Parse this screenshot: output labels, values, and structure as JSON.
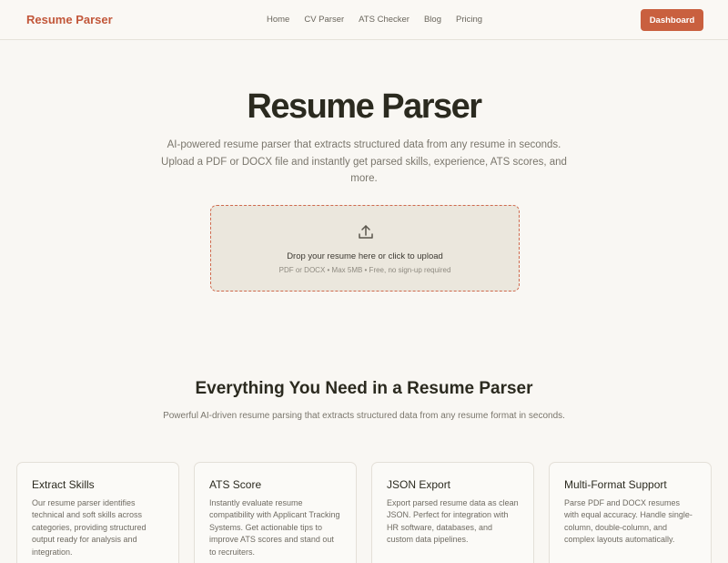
{
  "nav": {
    "brand": "Resume Parser",
    "links": [
      "Home",
      "CV Parser",
      "ATS Checker",
      "Blog",
      "Pricing"
    ],
    "dashboard_label": "Dashboard"
  },
  "hero": {
    "title": "Resume Parser",
    "subtitle": "AI-powered resume parser that extracts structured data from any resume in seconds. Upload a PDF or DOCX file and instantly get parsed skills, experience, ATS scores, and more."
  },
  "upload": {
    "icon": "upload-icon",
    "main_text": "Drop your resume here or click to upload",
    "hint": "PDF or DOCX • Max 5MB • Free, no sign-up required"
  },
  "features": {
    "title": "Everything You Need in a Resume Parser",
    "subtitle": "Powerful AI-driven resume parsing that extracts structured data from any resume format in seconds.",
    "cards": [
      {
        "title": "Extract Skills",
        "description": "Our resume parser identifies technical and soft skills across categories, providing structured output ready for analysis and integration."
      },
      {
        "title": "ATS Score",
        "description": "Instantly evaluate resume compatibility with Applicant Tracking Systems. Get actionable tips to improve ATS scores and stand out to recruiters."
      },
      {
        "title": "JSON Export",
        "description": "Export parsed resume data as clean JSON. Perfect for integration with HR software, databases, and custom data pipelines."
      },
      {
        "title": "Multi-Format Support",
        "description": "Parse PDF and DOCX resumes with equal accuracy. Handle single-column, double-column, and complex layouts automatically."
      }
    ]
  },
  "colors": {
    "accent": "#c9603f",
    "background": "#f9f7f3",
    "dropzone_bg": "#ebe7dd"
  }
}
